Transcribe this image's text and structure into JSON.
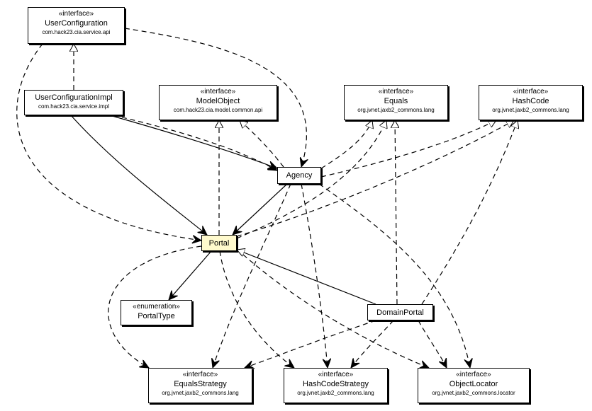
{
  "diagram": {
    "type": "uml-class-dependency",
    "focus_class": "Portal",
    "colors": {
      "focus_fill": "#fffacd",
      "default_fill": "#ffffff",
      "line": "#000000"
    },
    "nodes": {
      "userConfiguration": {
        "stereotype": "«interface»",
        "name": "UserConfiguration",
        "package": "com.hack23.cia.service.api"
      },
      "userConfigurationImpl": {
        "name": "UserConfigurationImpl",
        "package": "com.hack23.cia.service.impl"
      },
      "modelObject": {
        "stereotype": "«interface»",
        "name": "ModelObject",
        "package": "com.hack23.cia.model.common.api"
      },
      "equals": {
        "stereotype": "«interface»",
        "name": "Equals",
        "package": "org.jvnet.jaxb2_commons.lang"
      },
      "hashCode": {
        "stereotype": "«interface»",
        "name": "HashCode",
        "package": "org.jvnet.jaxb2_commons.lang"
      },
      "agency": {
        "name": "Agency"
      },
      "portal": {
        "name": "Portal"
      },
      "portalType": {
        "stereotype": "«enumeration»",
        "name": "PortalType"
      },
      "domainPortal": {
        "name": "DomainPortal"
      },
      "equalsStrategy": {
        "stereotype": "«interface»",
        "name": "EqualsStrategy",
        "package": "org.jvnet.jaxb2_commons.lang"
      },
      "hashCodeStrategy": {
        "stereotype": "«interface»",
        "name": "HashCodeStrategy",
        "package": "org.jvnet.jaxb2_commons.lang"
      },
      "objectLocator": {
        "stereotype": "«interface»",
        "name": "ObjectLocator",
        "package": "org.jvnet.jaxb2_commons.locator"
      }
    },
    "edges": [
      {
        "from": "userConfigurationImpl",
        "to": "userConfiguration",
        "kind": "realization"
      },
      {
        "from": "userConfigurationImpl",
        "to": "agency",
        "kind": "association"
      },
      {
        "from": "userConfigurationImpl",
        "to": "agency",
        "kind": "dependency"
      },
      {
        "from": "userConfigurationImpl",
        "to": "portal",
        "kind": "association"
      },
      {
        "from": "userConfiguration",
        "to": "agency",
        "kind": "dependency"
      },
      {
        "from": "userConfiguration",
        "to": "portal",
        "kind": "dependency"
      },
      {
        "from": "agency",
        "to": "modelObject",
        "kind": "realization"
      },
      {
        "from": "agency",
        "to": "equals",
        "kind": "realization"
      },
      {
        "from": "agency",
        "to": "hashCode",
        "kind": "realization"
      },
      {
        "from": "agency",
        "to": "portal",
        "kind": "association"
      },
      {
        "from": "agency",
        "to": "equalsStrategy",
        "kind": "dependency"
      },
      {
        "from": "agency",
        "to": "hashCodeStrategy",
        "kind": "dependency"
      },
      {
        "from": "agency",
        "to": "objectLocator",
        "kind": "dependency"
      },
      {
        "from": "portal",
        "to": "modelObject",
        "kind": "realization"
      },
      {
        "from": "portal",
        "to": "equals",
        "kind": "realization"
      },
      {
        "from": "portal",
        "to": "hashCode",
        "kind": "realization"
      },
      {
        "from": "portal",
        "to": "portalType",
        "kind": "association"
      },
      {
        "from": "portal",
        "to": "equalsStrategy",
        "kind": "dependency"
      },
      {
        "from": "portal",
        "to": "hashCodeStrategy",
        "kind": "dependency"
      },
      {
        "from": "portal",
        "to": "objectLocator",
        "kind": "dependency"
      },
      {
        "from": "domainPortal",
        "to": "portal",
        "kind": "generalization"
      },
      {
        "from": "domainPortal",
        "to": "equals",
        "kind": "realization"
      },
      {
        "from": "domainPortal",
        "to": "hashCode",
        "kind": "realization"
      },
      {
        "from": "domainPortal",
        "to": "equalsStrategy",
        "kind": "dependency"
      },
      {
        "from": "domainPortal",
        "to": "hashCodeStrategy",
        "kind": "dependency"
      },
      {
        "from": "domainPortal",
        "to": "objectLocator",
        "kind": "dependency"
      }
    ]
  }
}
